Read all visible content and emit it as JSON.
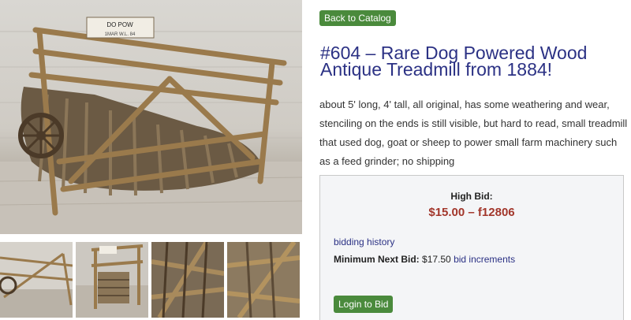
{
  "nav": {
    "back_label": "Back to Catalog"
  },
  "item": {
    "title": "#604 – Rare Dog Powered Wood Antique Treadmill from 1884!",
    "description": "about 5' long, 4' tall, all original, has some weathering and wear, stenciling on the ends is still visible, but hard to read, small treadmill that used dog, goat or sheep to power small farm machinery such as a feed grinder; no shipping"
  },
  "gallery": {
    "main_photo_icon": "treadmill-photo",
    "thumbnails": [
      "thumb-1",
      "thumb-2",
      "thumb-3",
      "thumb-4"
    ]
  },
  "bidding": {
    "high_bid_label": "High Bid:",
    "high_bid_value": "$15.00 – f12806",
    "history_label": "bidding history",
    "min_next_label": "Minimum Next Bid:",
    "min_next_value": "$17.50",
    "increments_label": "bid increments",
    "login_label": "Login to Bid"
  },
  "colors": {
    "accent_green": "#4a8a3c",
    "title_blue": "#2b3184",
    "bid_red": "#a2362b"
  }
}
